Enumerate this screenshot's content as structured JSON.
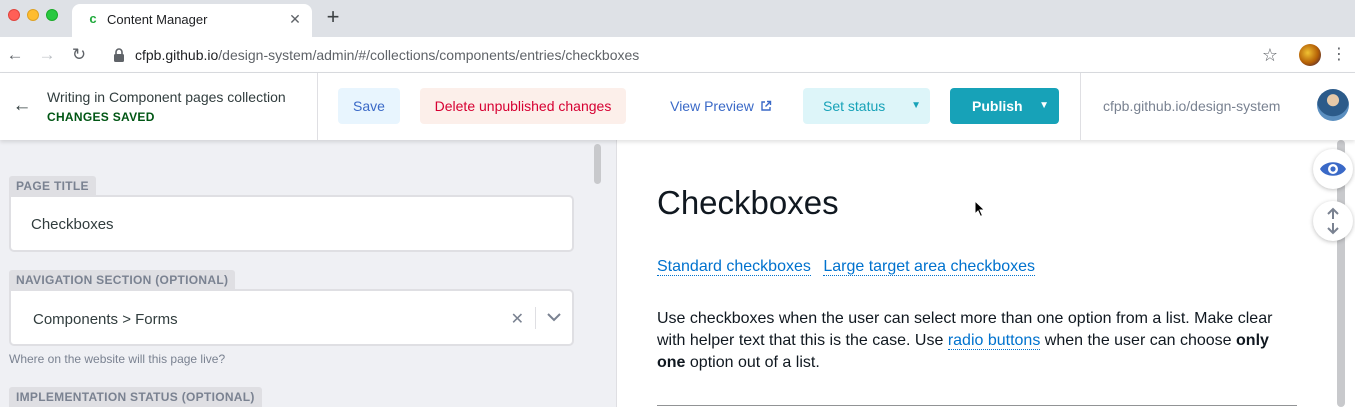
{
  "browser": {
    "tab": {
      "title": "Content Manager",
      "favicon": "c",
      "close": "✕"
    },
    "new_tab": "+",
    "nav": {
      "back": "←",
      "forward": "→",
      "reload": "↻"
    },
    "url": {
      "host": "cfpb.github.io",
      "path": "/design-system/admin/#/collections/components/entries/checkboxes"
    },
    "star": "☆",
    "menu": "⋮"
  },
  "header": {
    "back": "←",
    "title": "Writing in Component pages collection",
    "status": "CHANGES SAVED",
    "save_label": "Save",
    "delete_label": "Delete unpublished changes",
    "preview_label": "View Preview",
    "set_status_label": "Set status",
    "publish_label": "Publish",
    "caret": "▼",
    "site_url": "cfpb.github.io/design-system",
    "colors": {
      "primary": "#17a2b8",
      "link": "#3a69c7",
      "danger": "#d60032",
      "saved": "#005614"
    }
  },
  "form": {
    "page_title": {
      "label": "PAGE TITLE",
      "value": "Checkboxes"
    },
    "navigation_section": {
      "label": "NAVIGATION SECTION (OPTIONAL)",
      "value": "Components > Forms",
      "clear": "✕",
      "hint": "Where on the website will this page live?"
    },
    "implementation_status": {
      "label": "IMPLEMENTATION STATUS (OPTIONAL)"
    }
  },
  "preview": {
    "title": "Checkboxes",
    "links": [
      "Standard checkboxes",
      "Large target area checkboxes"
    ],
    "body": {
      "part1": "Use checkboxes when the user can select more than one option from a list. Make clear with helper text that this is the case. Use ",
      "link": "radio buttons",
      "part2": " when the user can choose ",
      "bold": "only one",
      "part3": " option out of a list."
    }
  }
}
